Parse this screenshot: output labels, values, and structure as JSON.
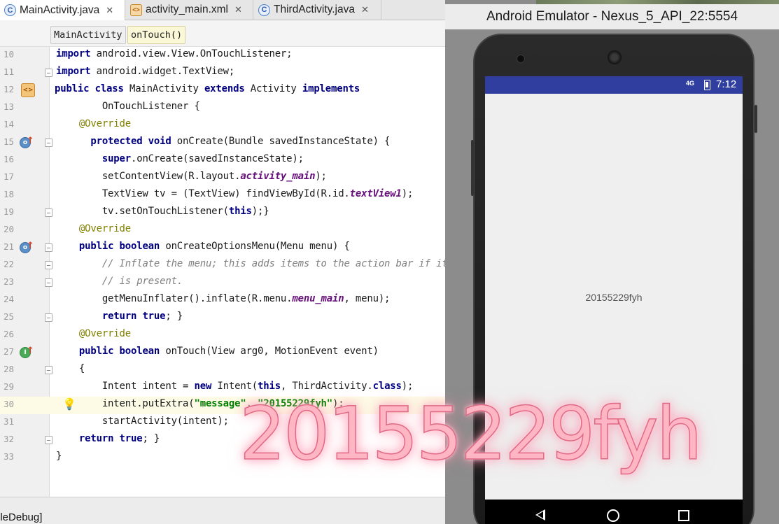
{
  "ide": {
    "tabs": [
      {
        "label": "MainActivity.java",
        "icon": "class-icon",
        "active": true
      },
      {
        "label": "activity_main.xml",
        "icon": "xml-layout-icon",
        "active": false
      },
      {
        "label": "ThirdActivity.java",
        "icon": "class-icon",
        "active": false
      }
    ],
    "tab_close_glyph": "✕",
    "breadcrumb": [
      "MainActivity",
      "onTouch()"
    ],
    "status_fragment": "oleDebug]",
    "lines": [
      {
        "num": "10",
        "code": "import android.view.View.OnTouchListener;"
      },
      {
        "num": "11",
        "code": "import android.widget.TextView;"
      },
      {
        "num": "12",
        "code": "public class MainActivity extends Activity implements"
      },
      {
        "num": "13",
        "code": "        OnTouchListener {"
      },
      {
        "num": "14",
        "code": "    @Override"
      },
      {
        "num": "15",
        "code": "      protected void onCreate(Bundle savedInstanceState) {"
      },
      {
        "num": "16",
        "code": "        super.onCreate(savedInstanceState);"
      },
      {
        "num": "17",
        "code": "        setContentView(R.layout.activity_main);"
      },
      {
        "num": "18",
        "code": "        TextView tv = (TextView) findViewById(R.id.textView1);"
      },
      {
        "num": "19",
        "code": "        tv.setOnTouchListener(this);}"
      },
      {
        "num": "20",
        "code": "    @Override"
      },
      {
        "num": "21",
        "code": "    public boolean onCreateOptionsMenu(Menu menu) {"
      },
      {
        "num": "22",
        "code": "        // Inflate the menu; this adds items to the action bar if it"
      },
      {
        "num": "23",
        "code": "        // is present."
      },
      {
        "num": "24",
        "code": "        getMenuInflater().inflate(R.menu.menu_main, menu);"
      },
      {
        "num": "25",
        "code": "        return true; }"
      },
      {
        "num": "26",
        "code": "    @Override"
      },
      {
        "num": "27",
        "code": "    public boolean onTouch(View arg0, MotionEvent event)"
      },
      {
        "num": "28",
        "code": "    {"
      },
      {
        "num": "29",
        "code": "        Intent intent = new Intent(this, ThirdActivity.class);"
      },
      {
        "num": "30",
        "code": "        intent.putExtra(\"message\", \"20155229fyh\");"
      },
      {
        "num": "31",
        "code": "        startActivity(intent);"
      },
      {
        "num": "32",
        "code": "    return true; }"
      },
      {
        "num": "33",
        "code": "}"
      }
    ]
  },
  "emulator": {
    "title": "Android Emulator - Nexus_5_API_22:5554",
    "network_label": "4G",
    "clock": "7:12",
    "screen_text": "20155229fyh",
    "nav": [
      "back-icon",
      "home-icon",
      "recents-icon"
    ]
  },
  "watermark": "20155229fyh"
}
